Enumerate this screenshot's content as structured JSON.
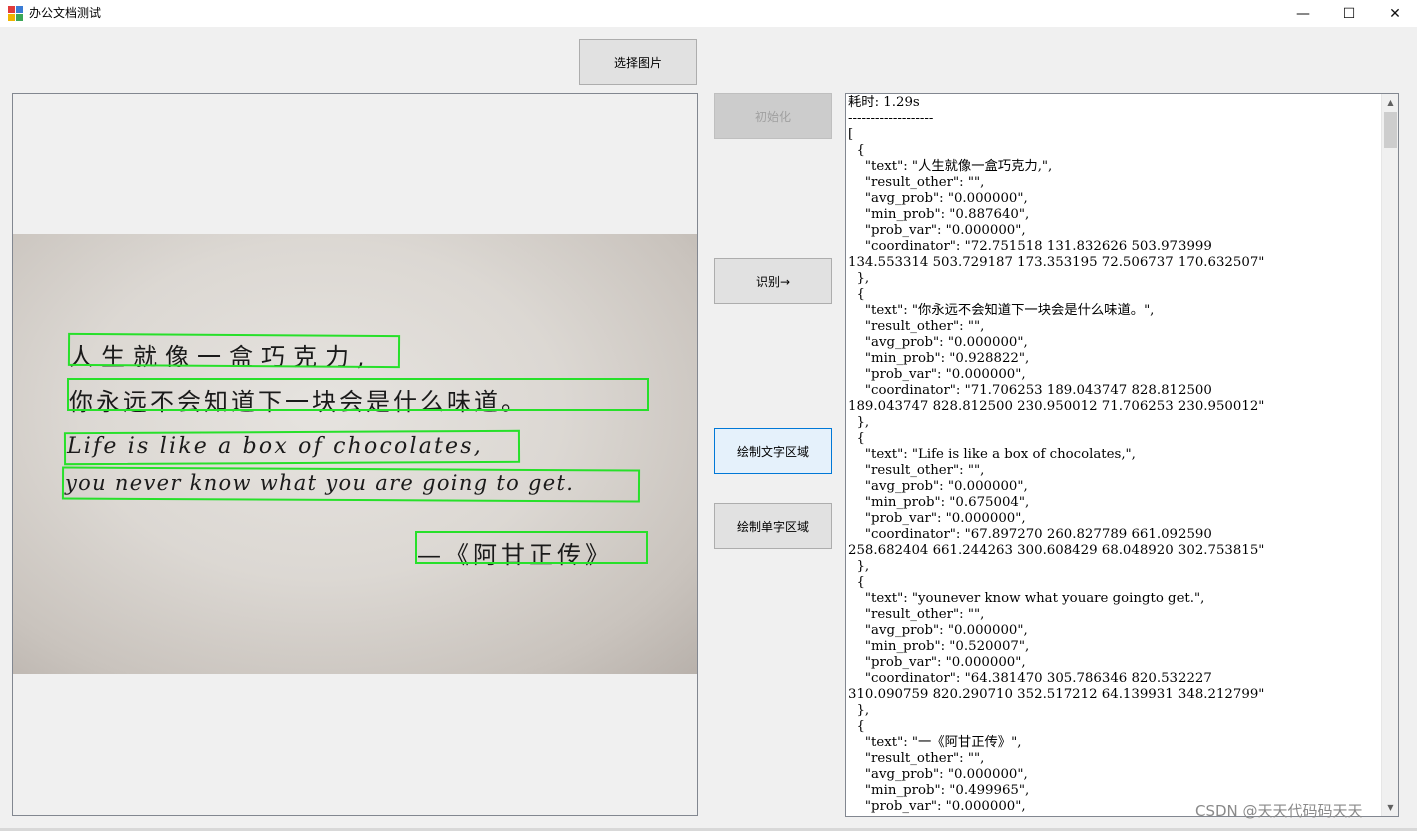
{
  "window": {
    "title": "办公文档测试",
    "controls": {
      "minimize": "—",
      "maximize": "☐",
      "close": "✕"
    }
  },
  "buttons": {
    "select_image": "选择图片",
    "init": "初始化",
    "recognize": "识别→",
    "draw_text_region": "绘制文字区域",
    "draw_char_region": "绘制单字区域"
  },
  "photo": {
    "lines": [
      "人生就像一盒巧克力,",
      "你永远不会知道下一块会是什么味道。",
      "Life is like a box of chocolates,",
      "you never know what you are going to get.",
      "—《阿甘正传》"
    ]
  },
  "result": {
    "text": "耗时: 1.29s\n-------------------\n[\n  {\n    \"text\": \"人生就像一盒巧克力,\",\n    \"result_other\": \"\",\n    \"avg_prob\": \"0.000000\",\n    \"min_prob\": \"0.887640\",\n    \"prob_var\": \"0.000000\",\n    \"coordinator\": \"72.751518 131.832626 503.973999\n134.553314 503.729187 173.353195 72.506737 170.632507\"\n  },\n  {\n    \"text\": \"你永远不会知道下一块会是什么味道。\",\n    \"result_other\": \"\",\n    \"avg_prob\": \"0.000000\",\n    \"min_prob\": \"0.928822\",\n    \"prob_var\": \"0.000000\",\n    \"coordinator\": \"71.706253 189.043747 828.812500\n189.043747 828.812500 230.950012 71.706253 230.950012\"\n  },\n  {\n    \"text\": \"Life is like a box of chocolates,\",\n    \"result_other\": \"\",\n    \"avg_prob\": \"0.000000\",\n    \"min_prob\": \"0.675004\",\n    \"prob_var\": \"0.000000\",\n    \"coordinator\": \"67.897270 260.827789 661.092590\n258.682404 661.244263 300.608429 68.048920 302.753815\"\n  },\n  {\n    \"text\": \"younever know what youare goingto get.\",\n    \"result_other\": \"\",\n    \"avg_prob\": \"0.000000\",\n    \"min_prob\": \"0.520007\",\n    \"prob_var\": \"0.000000\",\n    \"coordinator\": \"64.381470 305.786346 820.532227\n310.090759 820.290710 352.517212 64.139931 348.212799\"\n  },\n  {\n    \"text\": \"一《阿甘正传》\",\n    \"result_other\": \"\",\n    \"avg_prob\": \"0.000000\",\n    \"min_prob\": \"0.499965\",\n    \"prob_var\": \"0.000000\","
  },
  "scrollbar": {
    "up_arrow": "▲",
    "down_arrow": "▼"
  },
  "watermark": "CSDN @天天代码码天天",
  "colors": {
    "detection_box": "#27e02a",
    "focus_border": "#0078d7"
  }
}
